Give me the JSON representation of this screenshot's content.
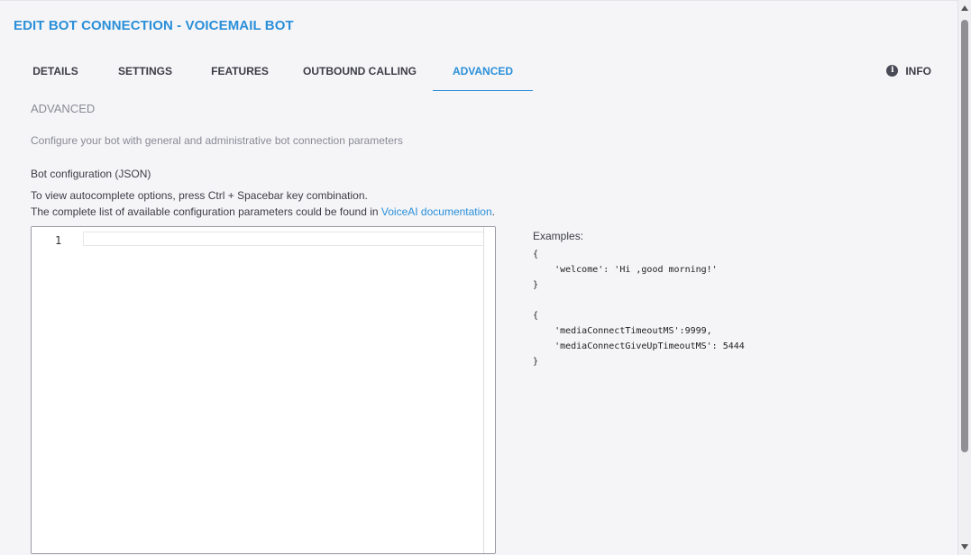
{
  "page": {
    "title": "EDIT BOT CONNECTION - VOICEMAIL BOT"
  },
  "tabs": [
    {
      "label": "DETAILS",
      "active": false
    },
    {
      "label": "SETTINGS",
      "active": false
    },
    {
      "label": "FEATURES",
      "active": false
    },
    {
      "label": "OUTBOUND CALLING",
      "active": false
    },
    {
      "label": "ADVANCED",
      "active": true
    }
  ],
  "info": {
    "label": "INFO",
    "icon": "info-icon",
    "glyph": "i"
  },
  "section": {
    "title": "ADVANCED",
    "description": "Configure your bot with general and administrative bot connection parameters"
  },
  "config": {
    "label": "Bot configuration (JSON)",
    "hint_autocomplete": "To view autocomplete options, press Ctrl + Spacebar key combination.",
    "hint_docs_prefix": "The complete list of available configuration parameters could be found in ",
    "docs_link": "VoiceAI documentation",
    "hint_docs_suffix": ".",
    "editor": {
      "line_number": "1",
      "value": ""
    }
  },
  "examples": {
    "label": "Examples:",
    "code": "{\n    'welcome': 'Hi ,good morning!'\n}\n\n{\n    'mediaConnectTimeoutMS':9999,\n    'mediaConnectGiveUpTimeoutMS': 5444\n}"
  },
  "colors": {
    "accent": "#2a8fd8",
    "text": "#3c3c46",
    "muted": "#8a8a96",
    "background": "#f5f5f8"
  }
}
